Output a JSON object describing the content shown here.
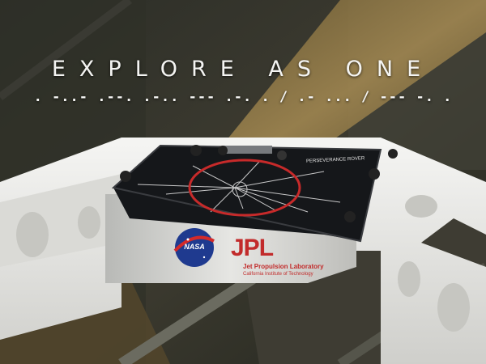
{
  "headline": "EXPLORE AS ONE",
  "morse": ". -..- .--. .-.. --- .-. . / .- ... / --- -. .",
  "plate": {
    "label": "PERSEVERANCE ROVER"
  },
  "logos": {
    "nasa": "NASA",
    "jpl": "JPL",
    "jpl_line1": "Jet Propulsion Laboratory",
    "jpl_line2": "California Institute of Technology"
  },
  "colors": {
    "highlight_circle": "#c72a2a",
    "text": "#f4f4f2"
  }
}
